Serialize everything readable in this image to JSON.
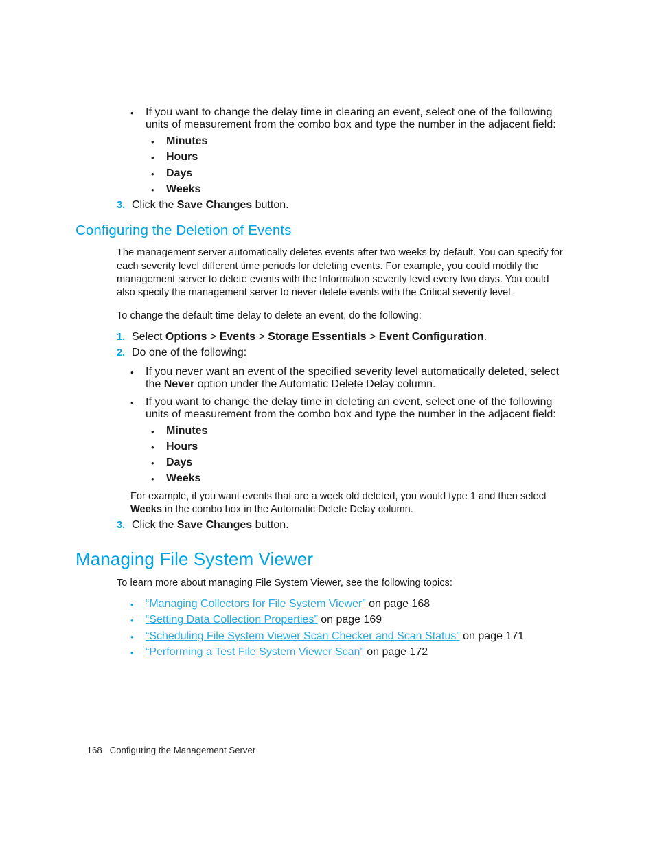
{
  "document": {
    "footer": {
      "page_number": "168",
      "chapter_title": "Configuring the Management Server"
    }
  },
  "clearing_section": {
    "bullet_intro": "If you want to change the delay time in clearing an event, select one of the following units of measurement from the combo box and type the number in the adjacent field:",
    "units": [
      "Minutes",
      "Hours",
      "Days",
      "Weeks"
    ],
    "step3": {
      "number": "3.",
      "text_before": "Click the ",
      "bold": "Save Changes",
      "text_after": " button."
    }
  },
  "deletion_section": {
    "heading": "Configuring the Deletion of Events",
    "intro_paragraph": "The management server automatically deletes events after two weeks by default. You can specify for each severity level different time periods for deleting events. For example, you could modify the management server to delete events with the Information severity level every two days. You could also specify the management server to never delete events with the Critical severity level.",
    "lead_in": "To change the default time delay to delete an event, do the following:",
    "step1": {
      "number": "1.",
      "text_before": "Select ",
      "menu_options": "Options",
      "sep1": " > ",
      "menu_events": "Events",
      "sep2": " > ",
      "menu_storage_essentials": "Storage Essentials",
      "sep3": " > ",
      "menu_event_configuration": "Event Configuration",
      "text_after": "."
    },
    "step2": {
      "number": "2.",
      "text": "Do one of the following:"
    },
    "bullet_never": {
      "part1": "If you never want an event of the specified severity level automatically deleted, select the ",
      "bold": "Never",
      "part2": " option under the Automatic Delete Delay column."
    },
    "bullet_delay": "If you want to change the delay time in deleting an event, select one of the following units of measurement from the combo box and type the number in the adjacent field:",
    "units": [
      "Minutes",
      "Hours",
      "Days",
      "Weeks"
    ],
    "example": {
      "part1": "For example, if you want events that are a week old deleted, you would type 1 and then select ",
      "bold": "Weeks",
      "part2": " in the combo box in the Automatic Delete Delay column."
    },
    "step3": {
      "number": "3.",
      "text_before": "Click the ",
      "bold": "Save Changes",
      "text_after": " button."
    }
  },
  "fsv_section": {
    "heading": "Managing File System Viewer",
    "lead_in": "To learn more about managing File System Viewer, see the following topics:",
    "topics": [
      {
        "open_quote": "“",
        "title": "Managing Collectors for File System Viewer",
        "close_quote": "”",
        "page_ref": " on page 168"
      },
      {
        "open_quote": "“",
        "title": "Setting Data Collection Properties",
        "close_quote": "”",
        "page_ref": " on page 169"
      },
      {
        "open_quote": "“",
        "title": "Scheduling File System Viewer Scan Checker and Scan Status",
        "close_quote": "”",
        "page_ref": " on page 171"
      },
      {
        "open_quote": "“",
        "title": "Performing a Test File System Viewer Scan",
        "close_quote": "”",
        "page_ref": " on page 172"
      }
    ]
  },
  "markers": {
    "bullet": "•",
    "bullet_small": "•"
  },
  "colors": {
    "heading": "#00a2e1",
    "link": "#29abe2",
    "body": "#1a1a1a"
  }
}
